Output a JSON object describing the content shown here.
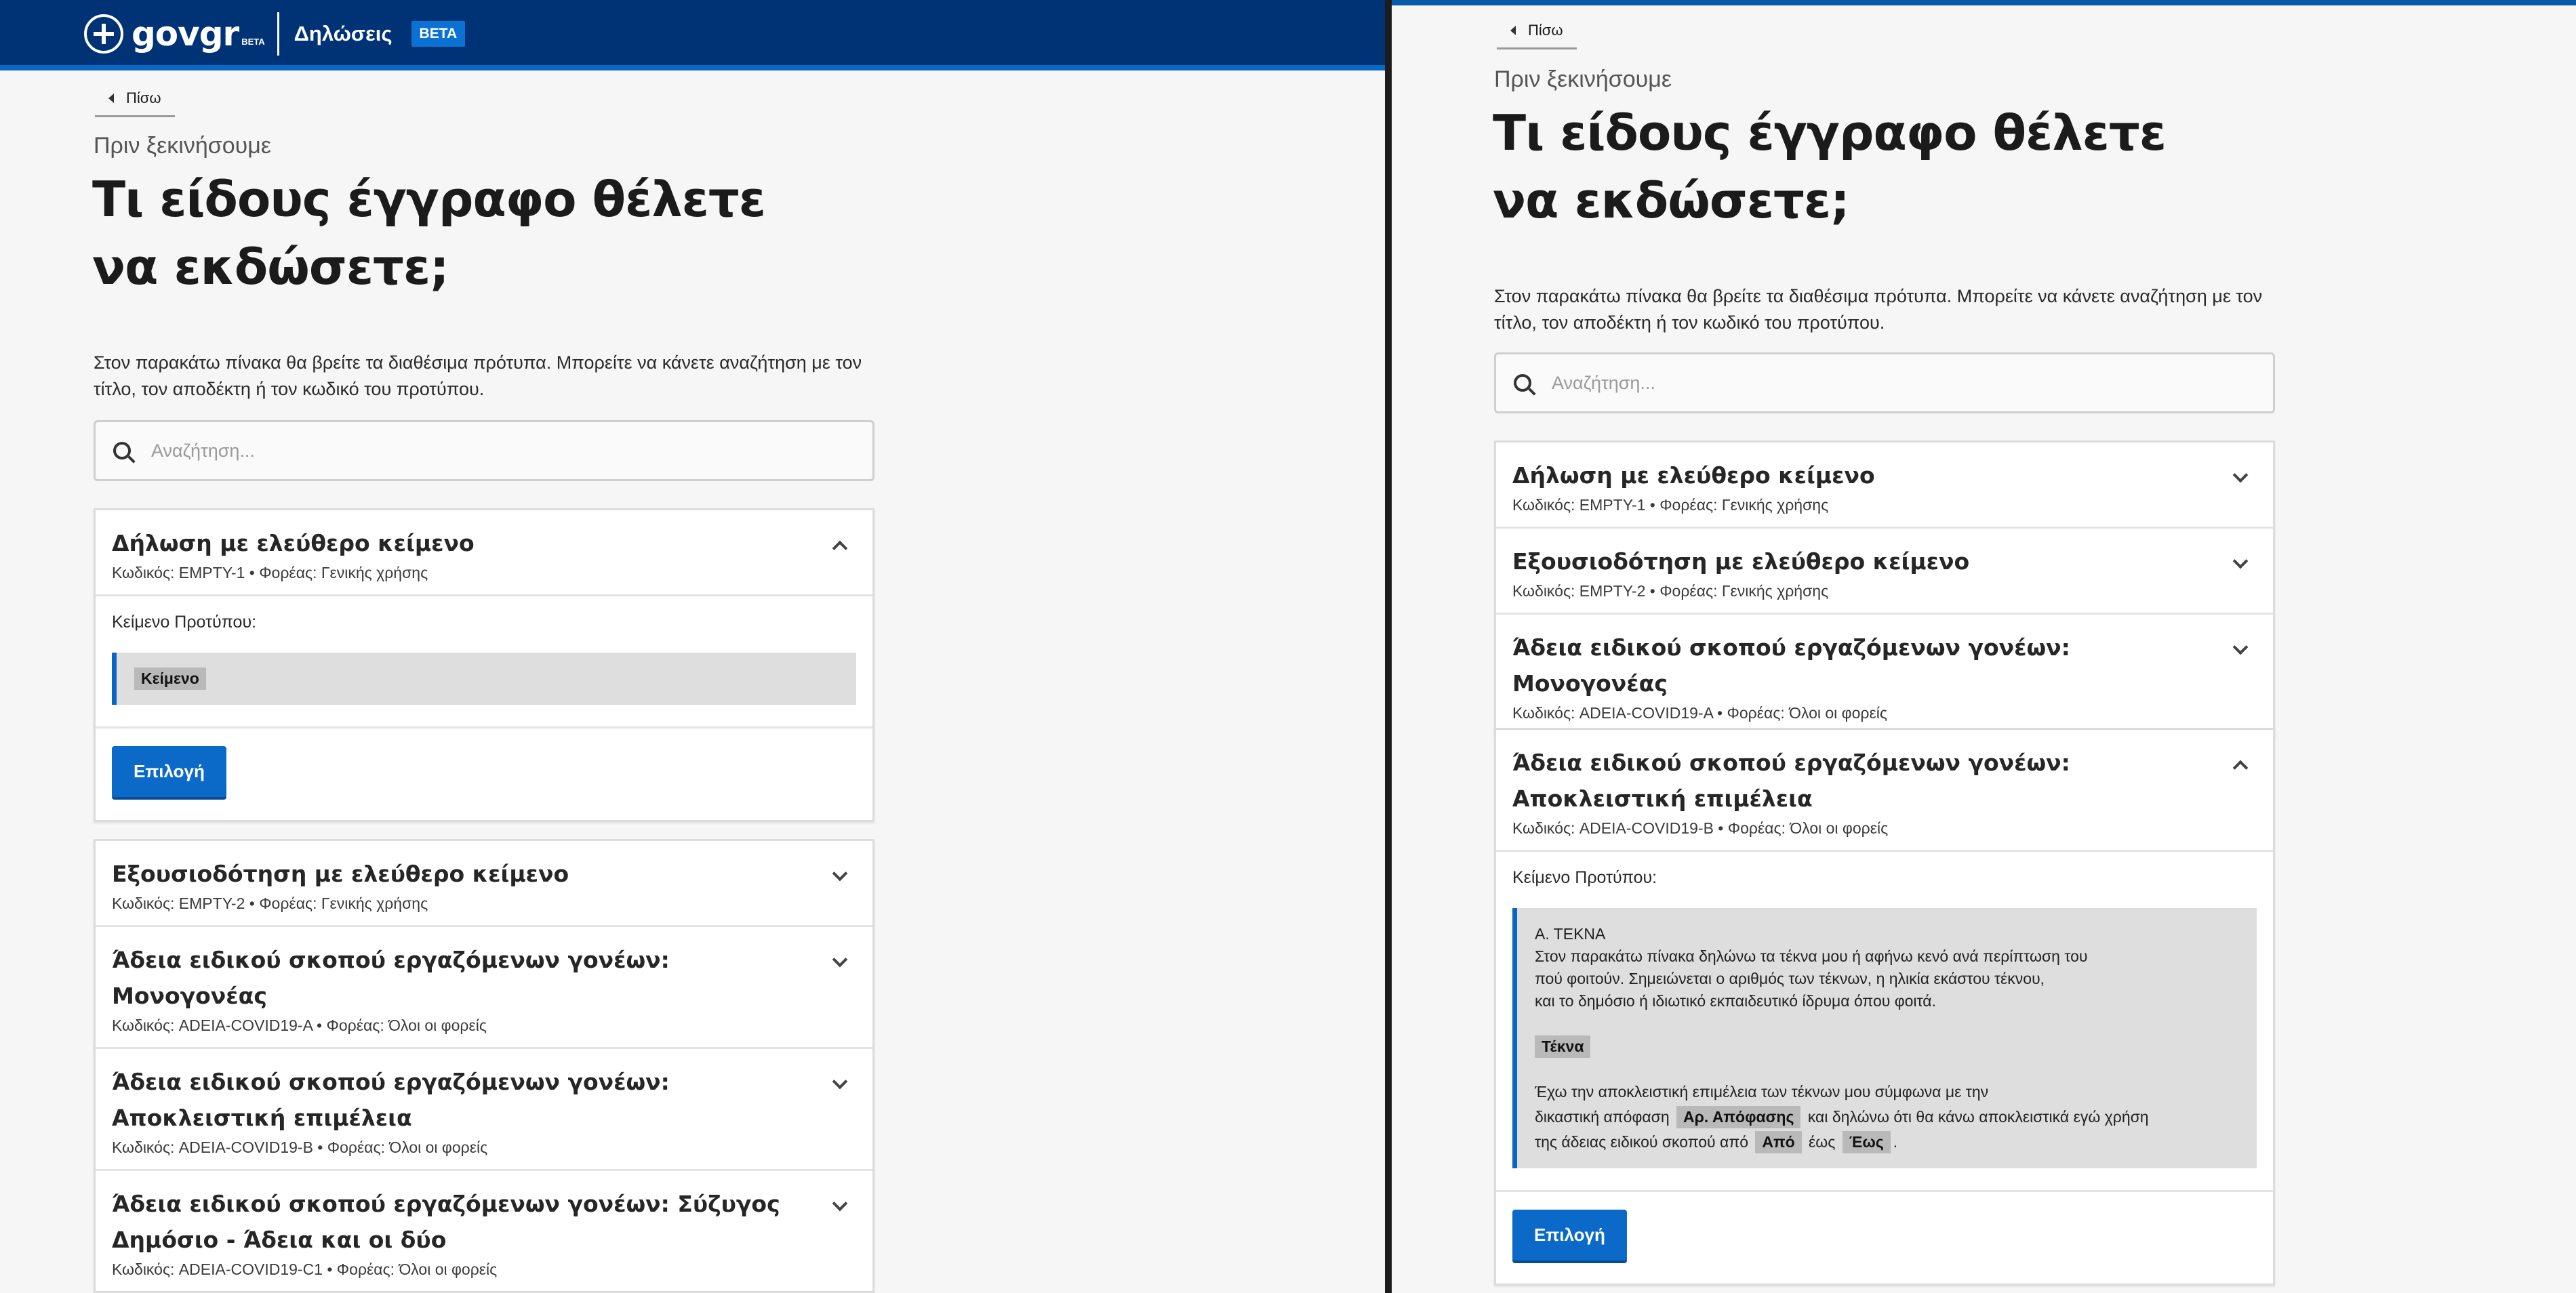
{
  "header": {
    "logo_text": "govgr",
    "logo_beta": "BETA",
    "app_name": "Δηλώσεις",
    "beta_badge": "BETA"
  },
  "back_label": "Πίσω",
  "overline": "Πριν ξεκινήσουμε",
  "title": "Τι είδους έγγραφο θέλετε να εκδώσετε;",
  "intro": "Στον παρακάτω πίνακα θα βρείτε τα διαθέσιμα πρότυπα. Μπορείτε να κάνετε αναζήτηση με τον τίτλο, τον αποδέκτη ή τον κωδικό του προτύπου.",
  "search_placeholder": "Αναζήτηση...",
  "template_label": "Κείμενο Προτύπου:",
  "select_button": "Επιλογή",
  "items": [
    {
      "title": "Δήλωση με ελεύθερο κείμενο",
      "meta": "Κωδικός: EMPTY-1 • Φορέας: Γενικής χρήσης"
    },
    {
      "title": "Εξουσιοδότηση με ελεύθερο κείμενο",
      "meta": "Κωδικός: EMPTY-2 • Φορέας: Γενικής χρήσης"
    },
    {
      "title": "Άδεια ειδικού σκοπού εργαζόμενων γονέων: Μονογονέας",
      "meta": "Κωδικός: ADEIA-COVID19-A • Φορέας: Όλοι οι φορείς"
    },
    {
      "title": "Άδεια ειδικού σκοπού εργαζόμενων γονέων: Αποκλειστική επιμέλεια",
      "meta": "Κωδικός: ADEIA-COVID19-B • Φορέας: Όλοι οι φορείς"
    },
    {
      "title": "Άδεια ειδικού σκοπού εργαζόμενων γονέων: Σύζυγος Δημόσιο - Άδεια και οι δύο",
      "meta": "Κωδικός: ADEIA-COVID19-C1 • Φορέας: Όλοι οι φορείς"
    }
  ],
  "left_template": {
    "field": "Κείμενο"
  },
  "right_template": {
    "heading": "Α. ΤΕΚΝΑ",
    "line1": "Στον παρακάτω πίνακα δηλώνω τα τέκνα μου ή αφήνω κενό ανά περίπτωση του",
    "line2": "πού φοιτούν. Σημειώνεται ο αριθμός των τέκνων, η ηλικία εκάστου τέκνου,",
    "line3": "και το δημόσιο ή ιδιωτικό εκπαιδευτικό ίδρυμα όπου φοιτά.",
    "field_children": "Τέκνα",
    "line4": "Έχω την αποκλειστική επιμέλεια των τέκνων μου σύμφωνα με την",
    "line5a": "δικαστική απόφαση",
    "field_decision": "Αρ. Απόφασης",
    "line5b": "και δηλώνω ότι θα κάνω αποκλειστικά εγώ χρήση",
    "line6a": "της άδειας ειδικού σκοπού από",
    "field_from": "Από",
    "line6b": "έως",
    "field_to": "Έως",
    "line6c": "."
  }
}
